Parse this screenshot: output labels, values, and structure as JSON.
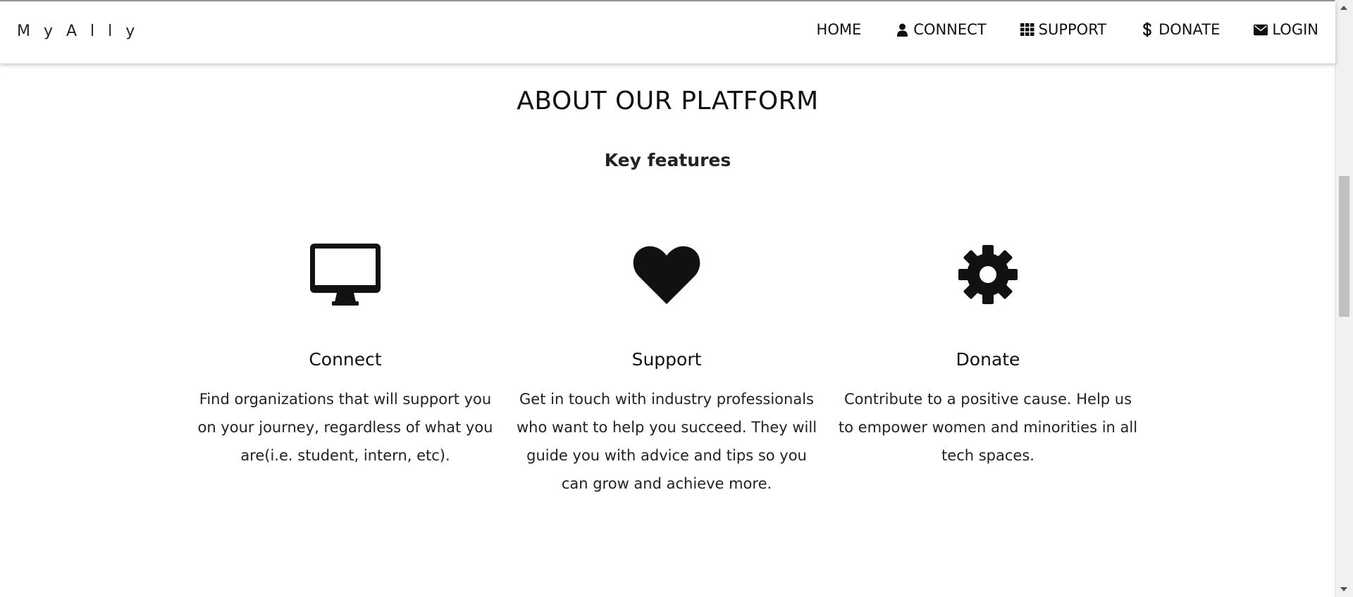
{
  "brand": {
    "name": "M y A l l y"
  },
  "nav": {
    "items": [
      {
        "label": "HOME",
        "icon": ""
      },
      {
        "label": "CONNECT",
        "icon": "user-icon"
      },
      {
        "label": "SUPPORT",
        "icon": "grid-icon"
      },
      {
        "label": "DONATE",
        "icon": "dollar-icon"
      },
      {
        "label": "LOGIN",
        "icon": "envelope-icon"
      }
    ]
  },
  "about": {
    "title": "ABOUT OUR PLATFORM",
    "subtitle": "Key features",
    "features": [
      {
        "icon": "desktop-icon",
        "title": "Connect",
        "text": "Find organizations that will support you on your journey, regardless of what you are(i.e. student, intern, etc)."
      },
      {
        "icon": "heart-icon",
        "title": "Support",
        "text": "Get in touch with industry professionals who want to help you succeed. They will guide you with advice and tips so you can grow and achieve more."
      },
      {
        "icon": "gear-icon",
        "title": "Donate",
        "text": "Contribute to a positive cause. Help us to empower women and minorities in all tech spaces."
      }
    ]
  }
}
